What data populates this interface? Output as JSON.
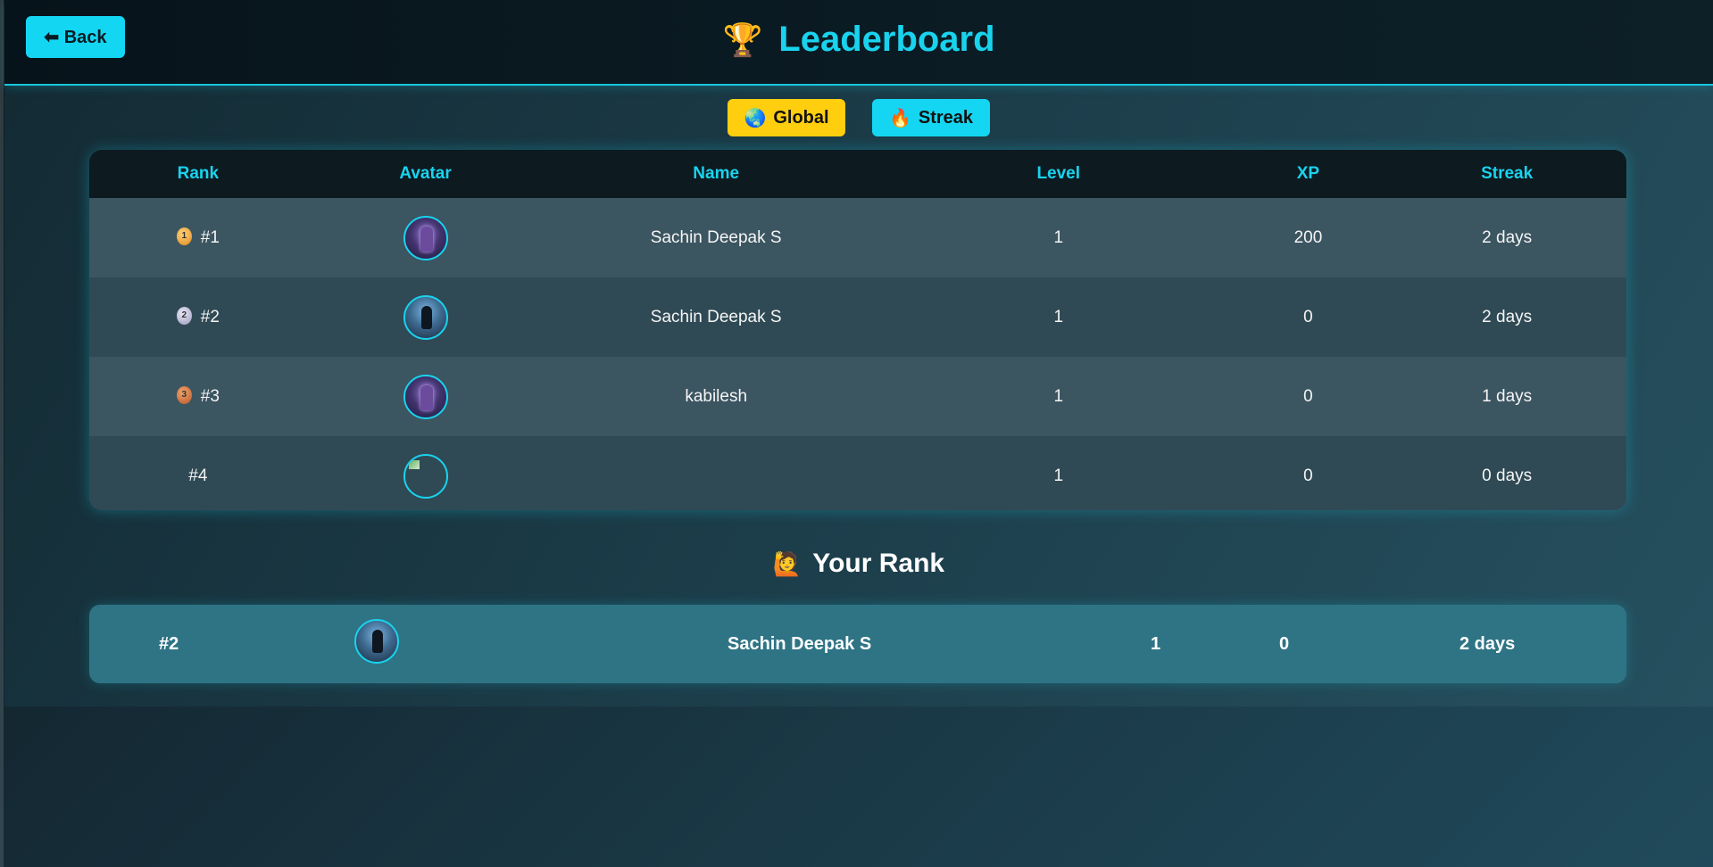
{
  "header": {
    "back_label": "⬅ Back",
    "title": "Leaderboard",
    "title_icon": "trophy-icon"
  },
  "tabs": [
    {
      "label": "Global",
      "icon": "globe-icon",
      "color": "#ffce0f"
    },
    {
      "label": "Streak",
      "icon": "fire-icon",
      "color": "#14d6f2"
    }
  ],
  "table": {
    "columns": [
      "Rank",
      "Avatar",
      "Name",
      "Level",
      "XP",
      "Streak"
    ],
    "rows": [
      {
        "rank": "#1",
        "medal": "gold",
        "name": "Sachin Deepak S",
        "level": "1",
        "xp": "200",
        "streak": "2 days"
      },
      {
        "rank": "#2",
        "medal": "silver",
        "name": "Sachin Deepak S",
        "level": "1",
        "xp": "0",
        "streak": "2 days"
      },
      {
        "rank": "#3",
        "medal": "bronze",
        "name": "kabilesh",
        "level": "1",
        "xp": "0",
        "streak": "1 days"
      },
      {
        "rank": "#4",
        "medal": "",
        "name": "",
        "level": "1",
        "xp": "0",
        "streak": "0 days"
      }
    ]
  },
  "your_rank": {
    "title": "Your Rank",
    "rank": "#2",
    "name": "Sachin Deepak S",
    "level": "1",
    "xp": "0",
    "streak": "2 days"
  },
  "colors": {
    "accent": "#19d3ee",
    "global_tab": "#ffce0f",
    "header_bg": "#0b1b23"
  }
}
